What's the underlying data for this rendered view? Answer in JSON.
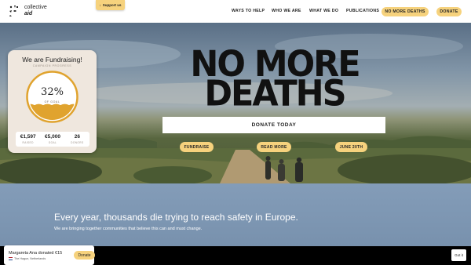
{
  "header": {
    "logo_line1": "collective",
    "logo_line2": "aid",
    "support_label": "Support us",
    "nav": {
      "ways_to_help": "WAYS TO HELP",
      "who_we_are": "WHO WE ARE",
      "what_we_do": "WHAT WE DO",
      "publications": "PUBLICATIONS",
      "no_more_deaths": "NO MORE DEATHS",
      "donate": "DONATE"
    }
  },
  "hero": {
    "headline_line1": "NO MORE",
    "headline_line2": "DEATHS",
    "donate_label": "DONATE TODAY",
    "pills": {
      "fundraise": "FUNDRAISE",
      "read_more": "READ MORE",
      "june": "JUNE 20TH"
    }
  },
  "fundraising": {
    "title": "We are Fundraising!",
    "subtitle": "CAMPAIGN PROGRESS",
    "percent": "32%",
    "percent_value": 0.32,
    "percent_label": "OF GOAL",
    "stats": [
      {
        "value": "€1,597",
        "label": "RAISED"
      },
      {
        "value": "€5,000",
        "label": "GOAL"
      },
      {
        "value": "26",
        "label": "DONORS"
      }
    ]
  },
  "section": {
    "title": "Every year, thousands die trying to reach safety in Europe.",
    "text": "We are bringing together communities that believe this can and must change."
  },
  "toast": {
    "name": "Margareta Ana donated €15",
    "location": "The Hague, Netherlands",
    "button": "Donate"
  },
  "cookie": {
    "button": "Got it"
  },
  "colors": {
    "accent": "#f6d27d",
    "gauge_fill": "#e0a32e",
    "card_bg": "#efe7de"
  },
  "icons": {
    "logo": "collective-aid-logo-icon",
    "support": "support-arrow-icon",
    "flag": "netherlands-flag-icon"
  }
}
